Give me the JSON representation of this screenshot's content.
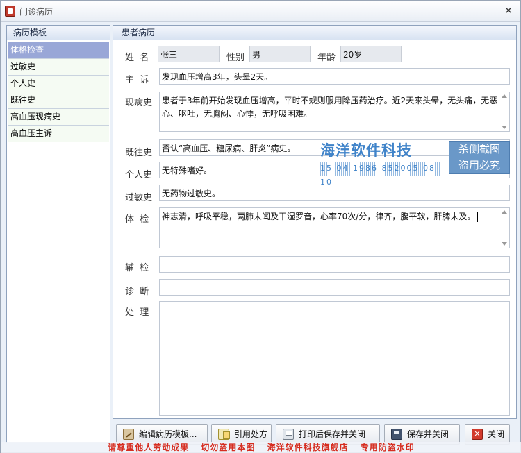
{
  "window": {
    "title": "门诊病历",
    "close": "✕"
  },
  "template_panel": {
    "header": "病历模板",
    "items": [
      "体格检查",
      "过敏史",
      "个人史",
      "既往史",
      "高血压现病史",
      "高血压主诉"
    ]
  },
  "record_panel": {
    "header": "患者病历",
    "name_label": "姓  名",
    "name_value": "张三",
    "sex_label": "性别",
    "sex_value": "男",
    "age_label": "年龄",
    "age_value": "20岁",
    "chief_label": "主  诉",
    "chief_value": "发现血压增高3年，头晕2天。",
    "present_label": "现病史",
    "present_value": "患者于3年前开始发现血压增高，平时不规则服用降压药治疗。近2天来头晕，无头痛，无恶心、呕吐，无胸闷、心悸，无呼吸困难。",
    "past_label": "既往史",
    "past_value": "否认“高血压、糖尿病、肝炎”病史。",
    "personal_label": "个人史",
    "personal_value": "无特殊嗜好。",
    "allergy_label": "过敏史",
    "allergy_value": "无药物过敏史。",
    "exam_label": "体  检",
    "exam_value": "神志清，呼吸平稳，两肺未闻及干湿罗音，心率70次/分，律齐，腹平软，肝脾未及。",
    "aux_label": "辅  检",
    "aux_value": "",
    "diag_label": "诊  断",
    "diag_value": "",
    "treat_label": "处  理",
    "treat_value": ""
  },
  "buttons": {
    "edit_template": "编辑病历模板...",
    "cite_prescription": "引用处方",
    "print_save_close": "打印后保存并关闭",
    "save_close": "保存并关闭",
    "close": "关闭"
  },
  "watermark": {
    "main": "海洋软件科技",
    "code": "15 04 1986 852005 08 10",
    "side_line1": "杀侧截图",
    "side_line2": "盗用必究",
    "bottom": "请尊重他人劳动成果 切勿盗用本图 海洋软件科技旗舰店 专用防盗水印"
  }
}
